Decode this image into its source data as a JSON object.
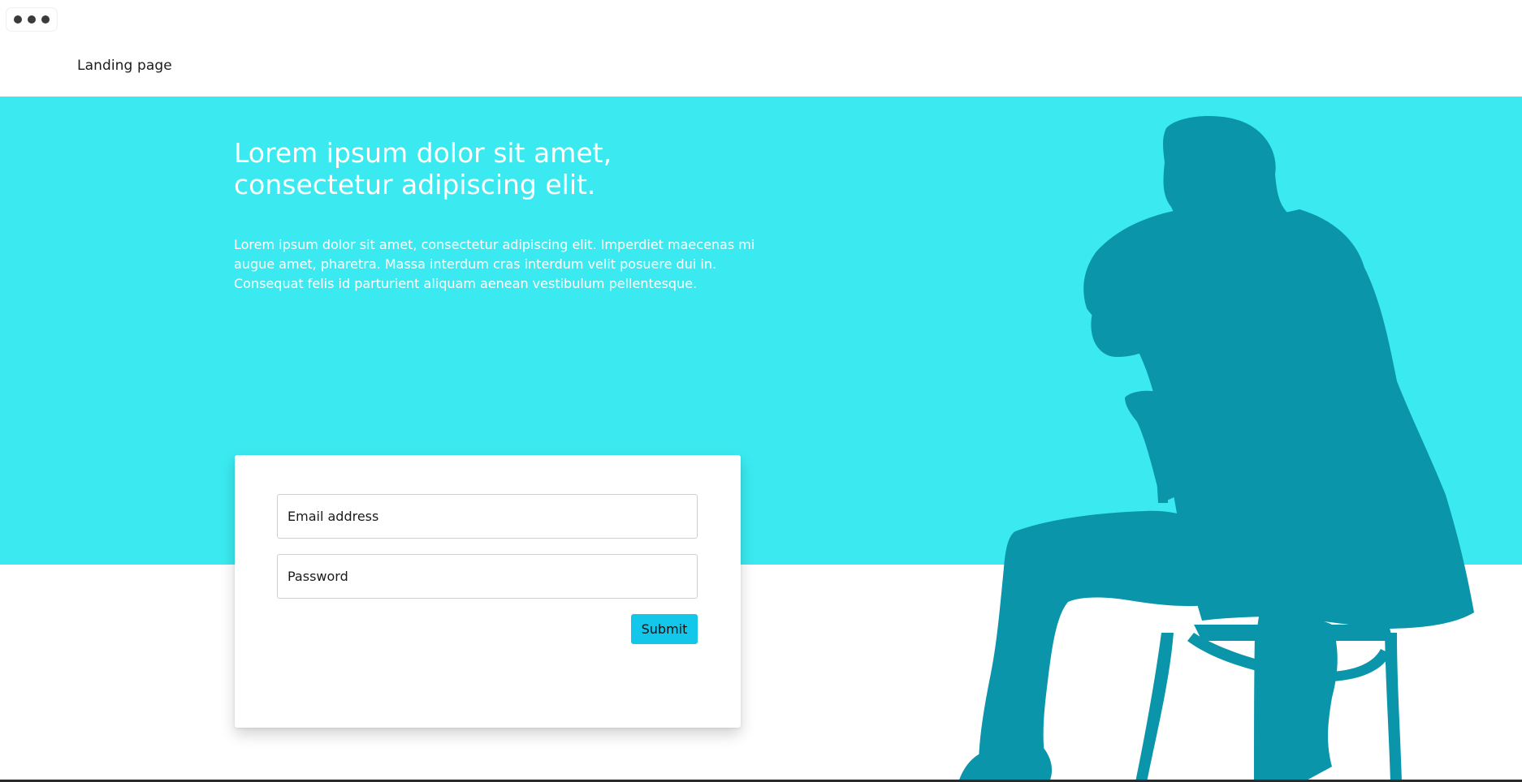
{
  "window": {
    "menu_icon": "more-horizontal-icon"
  },
  "header": {
    "title": "Landing page"
  },
  "hero": {
    "headline_line1": "Lorem ipsum dolor sit amet,",
    "headline_line2": "consectetur adipiscing elit.",
    "body": "Lorem ipsum dolor sit amet, consectetur adipiscing elit. Imperdiet maecenas mi augue amet, pharetra. Massa interdum cras interdum velit posuere dui in. Consequat felis id parturient aliquam aenean vestibulum pellentesque.",
    "background_color": "#3aeaf0",
    "illustration": "person-sitting-on-chair-silhouette",
    "illustration_color": "#0a95ab"
  },
  "form": {
    "email_placeholder": "Email address",
    "email_value": "",
    "password_placeholder": "Password",
    "password_value": "",
    "submit_label": "Submit",
    "submit_color": "#12c7ea"
  }
}
